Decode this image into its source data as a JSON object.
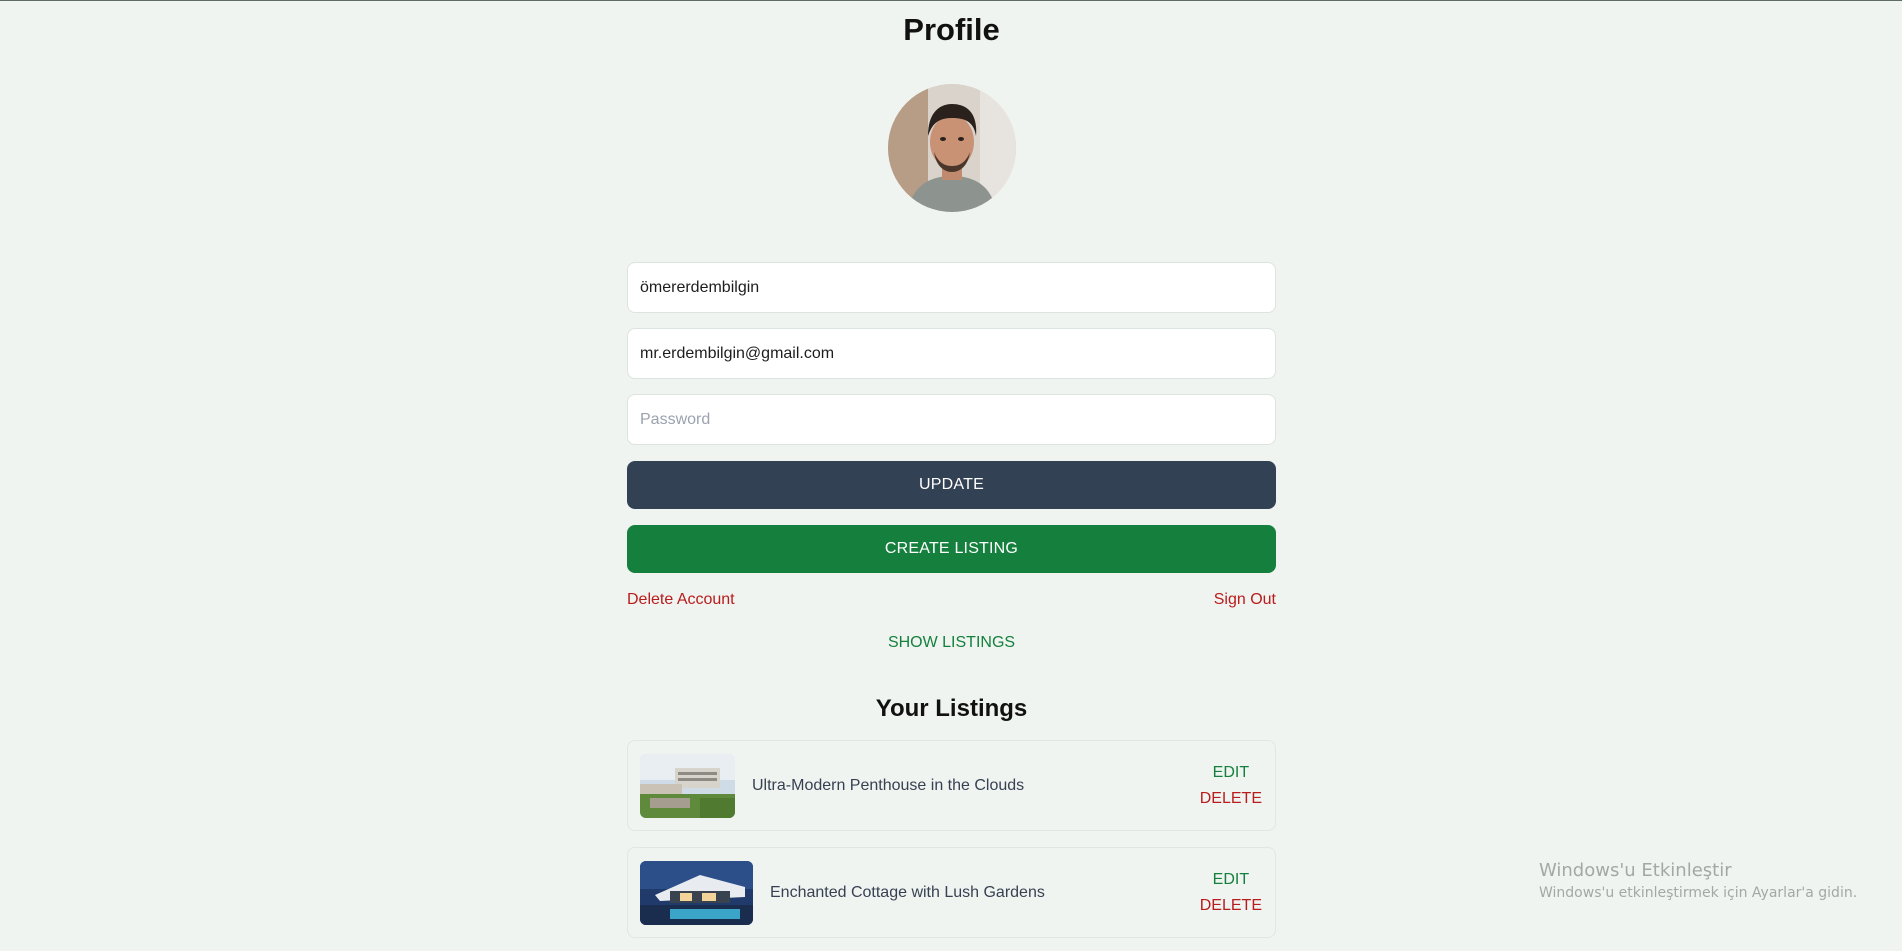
{
  "page": {
    "title": "Profile"
  },
  "form": {
    "username_value": "ömererdembilgin",
    "email_value": "mr.erdembilgin@gmail.com",
    "password_placeholder": "Password",
    "update_label": "UPDATE",
    "create_listing_label": "CREATE LISTING"
  },
  "account_links": {
    "delete_account": "Delete Account",
    "sign_out": "Sign Out"
  },
  "show_listings_label": "SHOW LISTINGS",
  "listings": {
    "title": "Your Listings",
    "items": [
      {
        "name": "Ultra-Modern Penthouse in the Clouds",
        "edit": "EDIT",
        "delete": "DELETE"
      },
      {
        "name": "Enchanted Cottage with Lush Gardens",
        "edit": "EDIT",
        "delete": "DELETE"
      }
    ]
  },
  "watermark": {
    "line1": "Windows'u Etkinleştir",
    "line2": "Windows'u etkinleştirmek için Ayarlar'a gidin."
  },
  "colors": {
    "background": "#f0f4f1",
    "update_button": "#334155",
    "create_button": "#15803d",
    "danger": "#b91c1c",
    "success": "#15803d"
  },
  "icons": {
    "avatar": "user-avatar-photo",
    "listing_thumb_0": "penthouse-photo",
    "listing_thumb_1": "cottage-photo"
  }
}
